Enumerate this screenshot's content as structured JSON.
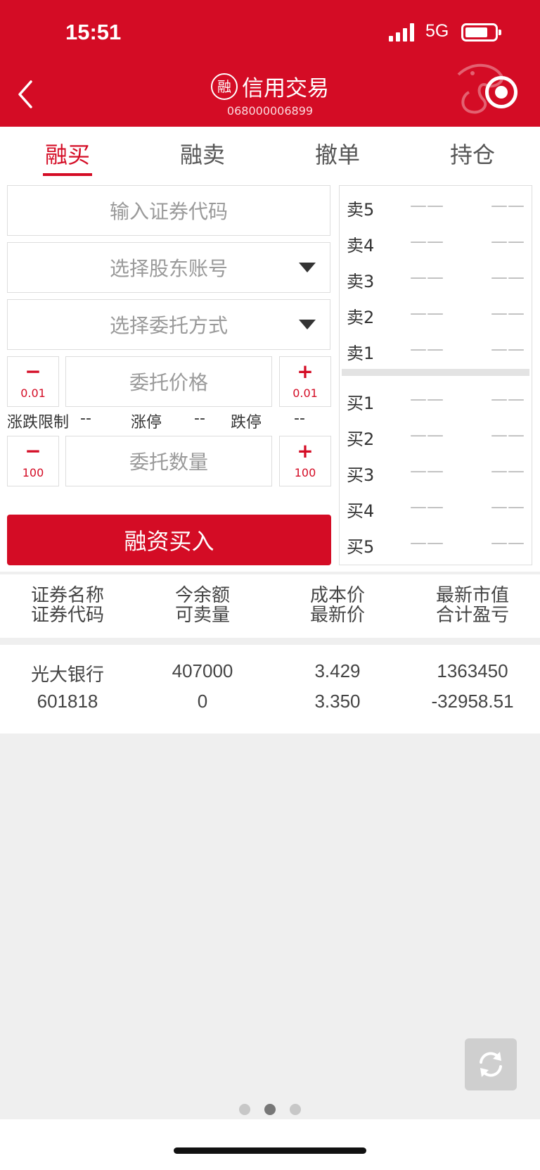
{
  "status": {
    "time": "15:51",
    "network": "5G"
  },
  "header": {
    "badge": "融",
    "title": "信用交易",
    "account": "068000006899"
  },
  "tabs": [
    {
      "label": "融买",
      "active": true
    },
    {
      "label": "融卖"
    },
    {
      "label": "撤单"
    },
    {
      "label": "持仓"
    }
  ],
  "form": {
    "code_placeholder": "输入证券代码",
    "shareholder_placeholder": "选择股东账号",
    "entrust_method_placeholder": "选择委托方式",
    "price_placeholder": "委托价格",
    "price_step": {
      "minus": "−",
      "plus": "+",
      "amount": "0.01"
    },
    "quantity_placeholder": "委托数量",
    "quantity_step": {
      "minus": "−",
      "plus": "+",
      "amount": "100"
    },
    "limits": {
      "label": "涨跌限制",
      "limit_value": "--",
      "up_label": "涨停",
      "up_value": "--",
      "down_label": "跌停",
      "down_value": "--"
    },
    "submit_label": "融资买入"
  },
  "order_book": {
    "sell": [
      {
        "label": "卖5",
        "price": "——",
        "volume": "——"
      },
      {
        "label": "卖4",
        "price": "——",
        "volume": "——"
      },
      {
        "label": "卖3",
        "price": "——",
        "volume": "——"
      },
      {
        "label": "卖2",
        "price": "——",
        "volume": "——"
      },
      {
        "label": "卖1",
        "price": "——",
        "volume": "——"
      }
    ],
    "buy": [
      {
        "label": "买1",
        "price": "——",
        "volume": "——"
      },
      {
        "label": "买2",
        "price": "——",
        "volume": "——"
      },
      {
        "label": "买3",
        "price": "——",
        "volume": "——"
      },
      {
        "label": "买4",
        "price": "——",
        "volume": "——"
      },
      {
        "label": "买5",
        "price": "——",
        "volume": "——"
      }
    ]
  },
  "positions": {
    "headers": [
      [
        "证券名称",
        "证券代码"
      ],
      [
        "今余额",
        "可卖量"
      ],
      [
        "成本价",
        "最新价"
      ],
      [
        "最新市值",
        "合计盈亏"
      ]
    ],
    "rows": [
      [
        [
          "光大银行",
          "601818"
        ],
        [
          "407000",
          "0"
        ],
        [
          "3.429",
          "3.350"
        ],
        [
          "1363450",
          "-32958.51"
        ]
      ]
    ]
  },
  "colors": {
    "brand": "#d40c25",
    "background": "#efefef"
  },
  "icons": {
    "back": "chevron-left-icon",
    "record": "record-icon",
    "refresh": "refresh-icon"
  },
  "pager": {
    "count": 3,
    "current": 2
  }
}
